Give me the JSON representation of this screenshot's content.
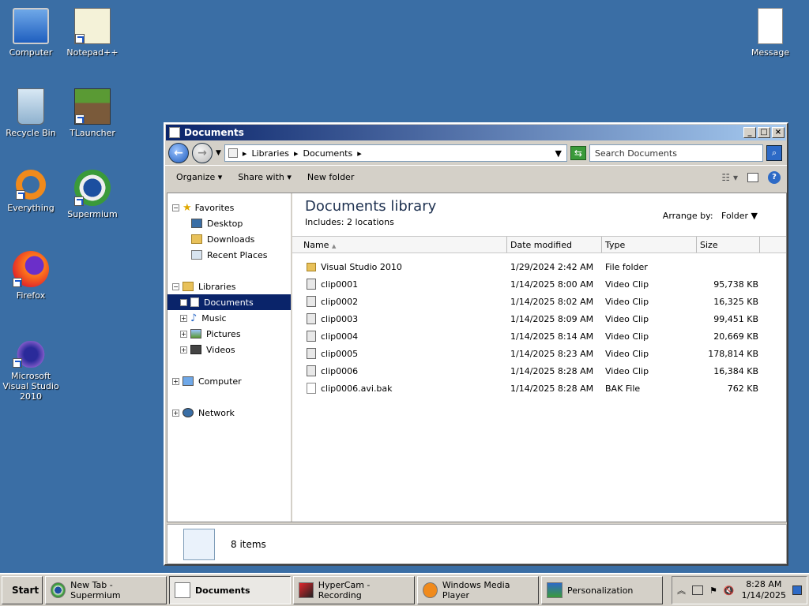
{
  "desktop": {
    "icons": [
      {
        "label": "Computer"
      },
      {
        "label": "Notepad++"
      },
      {
        "label": "Recycle Bin"
      },
      {
        "label": "TLauncher"
      },
      {
        "label": "Everything"
      },
      {
        "label": "Supermium"
      },
      {
        "label": "Firefox"
      },
      {
        "label": "Microsoft Visual Studio 2010"
      },
      {
        "label": "Message"
      }
    ]
  },
  "window": {
    "title": "Documents",
    "address": {
      "crumbs": [
        "Libraries",
        "Documents"
      ]
    },
    "search_placeholder": "Search Documents",
    "toolbar": {
      "organize": "Organize",
      "share": "Share with",
      "new_folder": "New folder"
    },
    "nav": {
      "favorites": "Favorites",
      "desktop": "Desktop",
      "downloads": "Downloads",
      "recent": "Recent Places",
      "libraries": "Libraries",
      "documents": "Documents",
      "music": "Music",
      "pictures": "Pictures",
      "videos": "Videos",
      "computer": "Computer",
      "network": "Network"
    },
    "library": {
      "title": "Documents library",
      "subtitle": "Includes:  2 locations",
      "arrange_label": "Arrange by:",
      "arrange_value": "Folder"
    },
    "columns": {
      "name": "Name",
      "date": "Date modified",
      "type": "Type",
      "size": "Size"
    },
    "files": [
      {
        "name": "Visual Studio 2010",
        "date": "1/29/2024 2:42 AM",
        "type": "File folder",
        "size": ""
      },
      {
        "name": "clip0001",
        "date": "1/14/2025 8:00 AM",
        "type": "Video Clip",
        "size": "95,738 KB"
      },
      {
        "name": "clip0002",
        "date": "1/14/2025 8:02 AM",
        "type": "Video Clip",
        "size": "16,325 KB"
      },
      {
        "name": "clip0003",
        "date": "1/14/2025 8:09 AM",
        "type": "Video Clip",
        "size": "99,451 KB"
      },
      {
        "name": "clip0004",
        "date": "1/14/2025 8:14 AM",
        "type": "Video Clip",
        "size": "20,669 KB"
      },
      {
        "name": "clip0005",
        "date": "1/14/2025 8:23 AM",
        "type": "Video Clip",
        "size": "178,814 KB"
      },
      {
        "name": "clip0006",
        "date": "1/14/2025 8:28 AM",
        "type": "Video Clip",
        "size": "16,384 KB"
      },
      {
        "name": "clip0006.avi.bak",
        "date": "1/14/2025 8:28 AM",
        "type": "BAK File",
        "size": "762 KB"
      }
    ],
    "details": {
      "count": "8 items"
    }
  },
  "taskbar": {
    "start": "Start",
    "items": [
      "New Tab - Supermium",
      "Documents",
      "HyperCam - Recording",
      "Windows Media Player",
      "Personalization"
    ],
    "time": "8:28 AM",
    "date": "1/14/2025"
  }
}
